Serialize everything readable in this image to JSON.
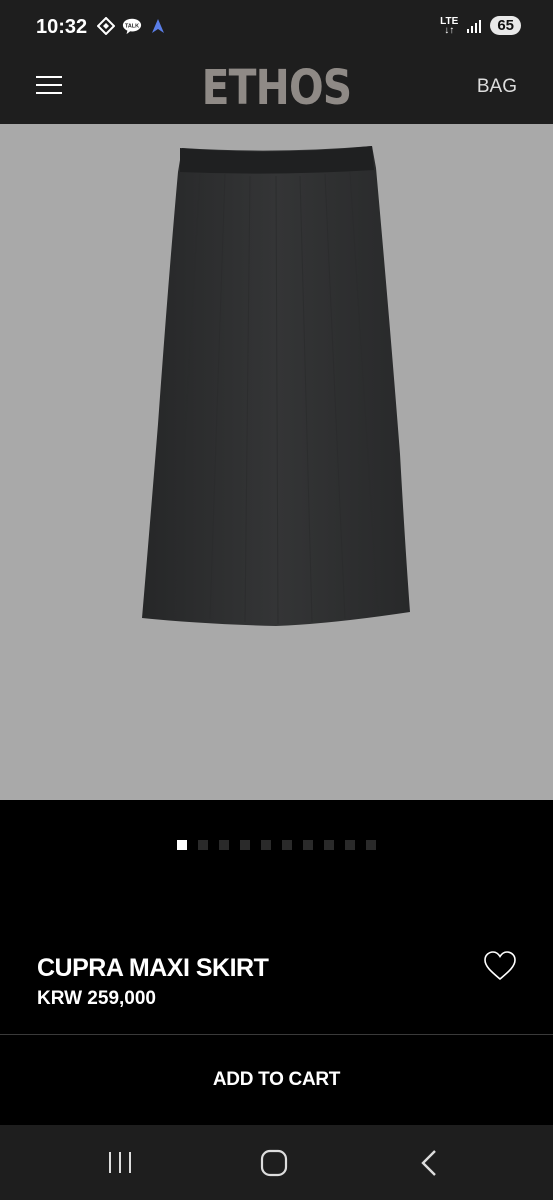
{
  "status_bar": {
    "time": "10:32",
    "network": "LTE",
    "battery": "65",
    "icons": [
      "sync-icon",
      "talk-icon",
      "navigation-icon",
      "lte-icon",
      "signal-icon",
      "battery-icon"
    ],
    "talk_label": "TALK"
  },
  "header": {
    "brand": "ETHOS",
    "bag_label": "BAG"
  },
  "product": {
    "name": "CUPRA MAXI SKIRT",
    "price": "KRW 259,000",
    "image_alt_colors": {
      "background": "#a9a9a9",
      "garment": "#2e2f30"
    },
    "gallery_count": 10,
    "gallery_active_index": 0
  },
  "actions": {
    "add_to_cart": "ADD TO CART"
  },
  "nav_bar": {
    "icons": [
      "recent-apps-icon",
      "home-icon",
      "back-icon"
    ]
  }
}
